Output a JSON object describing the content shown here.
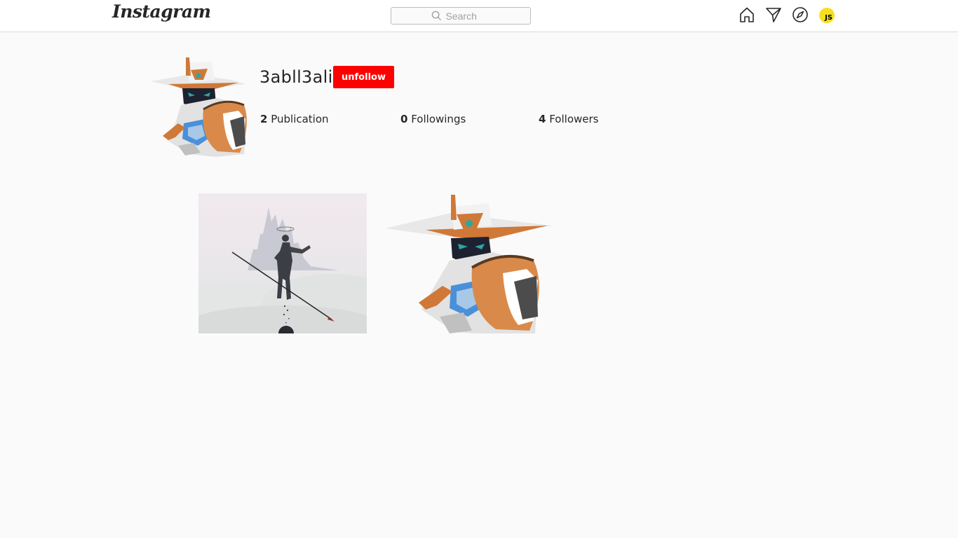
{
  "header": {
    "logo": "Instagram",
    "search_placeholder": "Search",
    "user_initials": "JS",
    "colors": {
      "user_badge": "#f7df1e"
    },
    "icons": [
      "home-icon",
      "direct-send-icon",
      "explore-compass-icon"
    ]
  },
  "profile": {
    "username": "3abll3ali",
    "action_button": "unfollow",
    "action_color": "#ff0000",
    "stats": {
      "publications": {
        "count": "2",
        "label": "Publication"
      },
      "followings": {
        "count": "0",
        "label": "Followings"
      },
      "followers": {
        "count": "4",
        "label": "Followers"
      }
    }
  },
  "posts": [
    {
      "id": "post-1",
      "image": "figure-with-spear-in-clouds"
    },
    {
      "id": "post-2",
      "image": "robot-character-with-hat"
    }
  ]
}
